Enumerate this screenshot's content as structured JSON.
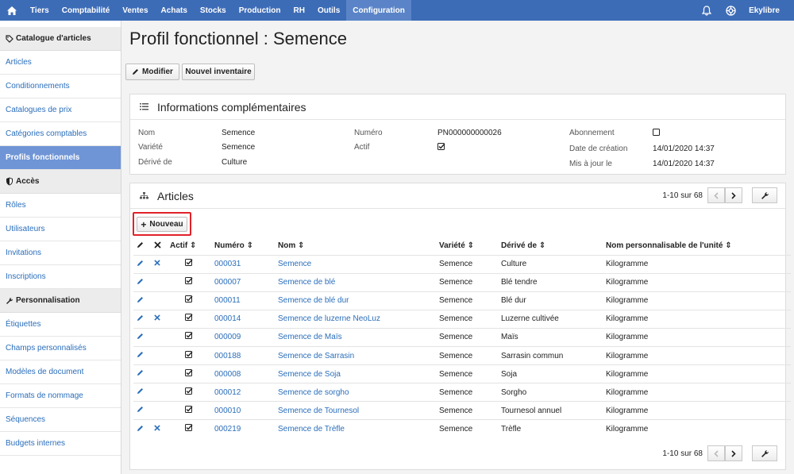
{
  "topnav": {
    "items": [
      "Tiers",
      "Comptabilité",
      "Ventes",
      "Achats",
      "Stocks",
      "Production",
      "RH",
      "Outils",
      "Configuration"
    ],
    "active": "Configuration",
    "user": "Ekylibre"
  },
  "sidebar": {
    "sections": [
      {
        "title": "Catalogue d'articles",
        "icon": "tag-icon",
        "items": [
          "Articles",
          "Conditionnements",
          "Catalogues de prix",
          "Catégories comptables",
          "Profils fonctionnels"
        ]
      },
      {
        "title": "Accès",
        "icon": "shield-icon",
        "items": [
          "Rôles",
          "Utilisateurs",
          "Invitations",
          "Inscriptions"
        ]
      },
      {
        "title": "Personnalisation",
        "icon": "wrench-icon",
        "items": [
          "Étiquettes",
          "Champs personnalisés",
          "Modèles de document",
          "Formats de nommage",
          "Séquences",
          "Budgets internes"
        ]
      }
    ],
    "active_item": "Profils fonctionnels"
  },
  "page": {
    "title": "Profil fonctionnel : Semence",
    "modify_label": "Modifier",
    "new_inventory_label": "Nouvel inventaire"
  },
  "info": {
    "heading": "Informations complémentaires",
    "nom_label": "Nom",
    "nom_value": "Semence",
    "variete_label": "Variété",
    "variete_value": "Semence",
    "derive_label": "Dérivé de",
    "derive_value": "Culture",
    "numero_label": "Numéro",
    "numero_value": "PN000000000026",
    "actif_label": "Actif",
    "actif_value": true,
    "abonnement_label": "Abonnement",
    "abonnement_value": false,
    "creation_label": "Date de création",
    "creation_value": "14/01/2020 14:37",
    "maj_label": "Mis à jour le",
    "maj_value": "14/01/2020 14:37"
  },
  "articles": {
    "heading": "Articles",
    "new_label": "Nouveau",
    "pagination": "1-10 sur 68",
    "columns": [
      "Actif",
      "Numéro",
      "Nom",
      "Variété",
      "Dérivé de",
      "Nom personnalisable de l'unité"
    ],
    "rows": [
      {
        "deletable": true,
        "actif": true,
        "numero": "000031",
        "nom": "Semence",
        "variete": "Semence",
        "derive": "Culture",
        "unite": "Kilogramme"
      },
      {
        "deletable": false,
        "actif": true,
        "numero": "000007",
        "nom": "Semence de blé",
        "variete": "Semence",
        "derive": "Blé tendre",
        "unite": "Kilogramme"
      },
      {
        "deletable": false,
        "actif": true,
        "numero": "000011",
        "nom": "Semence de blé dur",
        "variete": "Semence",
        "derive": "Blé dur",
        "unite": "Kilogramme"
      },
      {
        "deletable": true,
        "actif": true,
        "numero": "000014",
        "nom": "Semence de luzerne NeoLuz",
        "variete": "Semence",
        "derive": "Luzerne cultivée",
        "unite": "Kilogramme"
      },
      {
        "deletable": false,
        "actif": true,
        "numero": "000009",
        "nom": "Semence de Maïs",
        "variete": "Semence",
        "derive": "Maïs",
        "unite": "Kilogramme"
      },
      {
        "deletable": false,
        "actif": true,
        "numero": "000188",
        "nom": "Semence de Sarrasin",
        "variete": "Semence",
        "derive": "Sarrasin commun",
        "unite": "Kilogramme"
      },
      {
        "deletable": false,
        "actif": true,
        "numero": "000008",
        "nom": "Semence de Soja",
        "variete": "Semence",
        "derive": "Soja",
        "unite": "Kilogramme"
      },
      {
        "deletable": false,
        "actif": true,
        "numero": "000012",
        "nom": "Semence de sorgho",
        "variete": "Semence",
        "derive": "Sorgho",
        "unite": "Kilogramme"
      },
      {
        "deletable": false,
        "actif": true,
        "numero": "000010",
        "nom": "Semence de Tournesol",
        "variete": "Semence",
        "derive": "Tournesol annuel",
        "unite": "Kilogramme"
      },
      {
        "deletable": true,
        "actif": true,
        "numero": "000219",
        "nom": "Semence de Trèfle",
        "variete": "Semence",
        "derive": "Trèfle",
        "unite": "Kilogramme"
      }
    ]
  },
  "colors": {
    "nav": "#3d6cb7",
    "nav_active": "#5a84c7",
    "sidebar_active": "#6f95d6",
    "link": "#2a6ebb",
    "highlight": "#e0222a"
  }
}
